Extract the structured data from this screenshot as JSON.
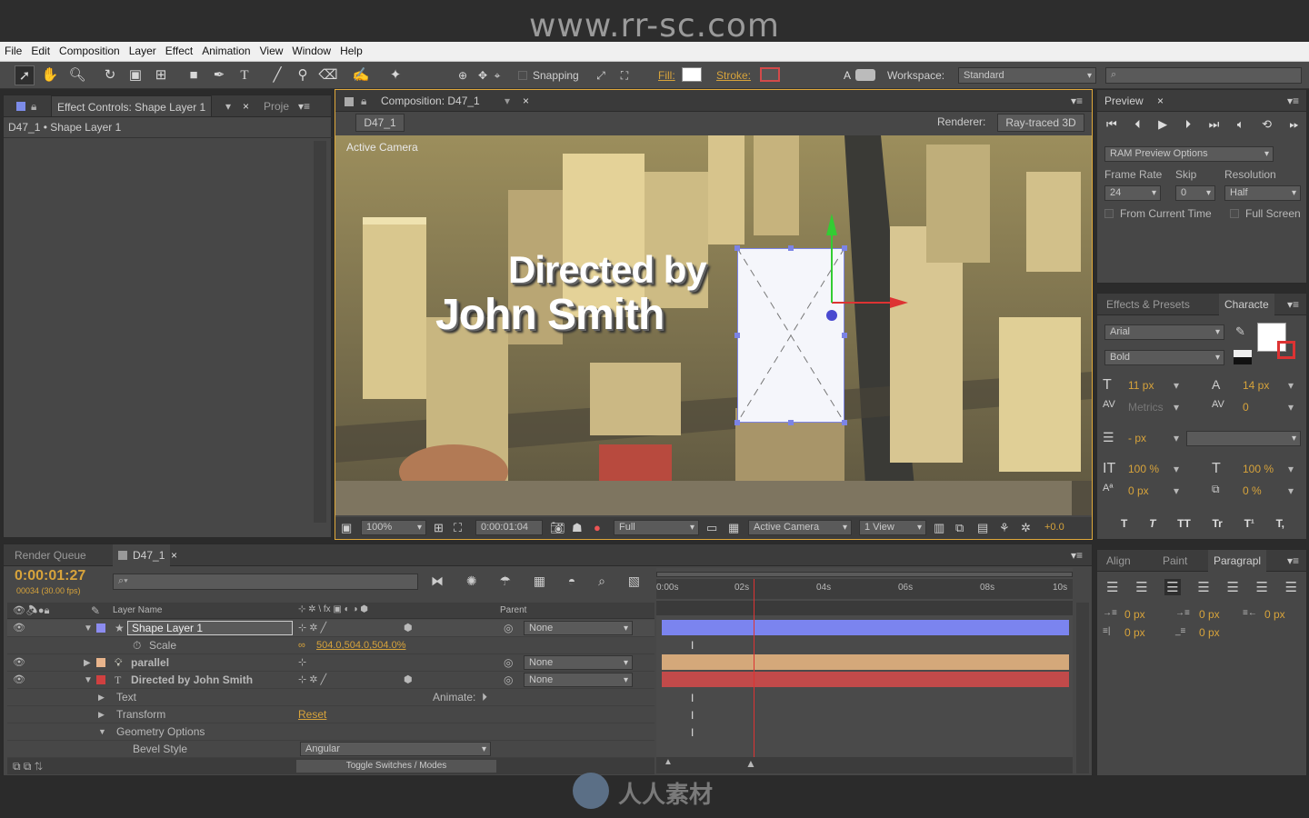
{
  "watermark": "www.rr-sc.com",
  "menu": [
    "File",
    "Edit",
    "Composition",
    "Layer",
    "Effect",
    "Animation",
    "View",
    "Window",
    "Help"
  ],
  "toolbar": {
    "snapping": "Snapping",
    "fill": "Fill:",
    "stroke": "Stroke:",
    "workspace_label": "Workspace:",
    "workspace_value": "Standard",
    "search_placeholder": ""
  },
  "left_panel": {
    "tab": "Effect Controls: Shape Layer 1",
    "tab2": "Proje",
    "breadcrumb": "D47_1 • Shape Layer 1"
  },
  "comp": {
    "tab": "Composition: D47_1",
    "subtab": "D47_1",
    "renderer_label": "Renderer:",
    "renderer_value": "Ray-traced 3D",
    "camera_label": "Active Camera",
    "title_line1": "Directed by",
    "title_line2": "John Smith",
    "footer": {
      "zoom": "100%",
      "timecode": "0:00:01:04",
      "resolution": "Full",
      "camera": "Active Camera",
      "views": "1 View",
      "exposure": "+0.0"
    }
  },
  "preview": {
    "tab": "Preview",
    "ram": "RAM Preview Options",
    "frame_rate_label": "Frame Rate",
    "skip_label": "Skip",
    "resolution_label": "Resolution",
    "frame_rate": "24",
    "skip": "0",
    "resolution": "Half",
    "from_current": "From Current Time",
    "full_screen": "Full Screen"
  },
  "character": {
    "tab1": "Effects & Presets",
    "tab2": "Characte",
    "font": "Arial",
    "style": "Bold",
    "size": "11 px",
    "leading": "14 px",
    "kerning": "Metrics",
    "tracking": "0",
    "stroke_px": "- px",
    "vscale": "100 %",
    "hscale": "100 %",
    "baseline": "0 px",
    "tsume": "0 %",
    "styles": [
      "T",
      "T",
      "TT",
      "Tr",
      "T¹",
      "T,"
    ]
  },
  "paragraph": {
    "tab1": "Align",
    "tab2": "Paint",
    "tab3": "Paragrapl",
    "indent1": "0 px",
    "indent2": "0 px",
    "indent3": "0 px",
    "space1": "0 px",
    "space2": "0 px"
  },
  "timeline": {
    "tab1": "Render Queue",
    "tab2": "D47_1",
    "timecode": "0:00:01:27",
    "fps": "00034 (30.00 fps)",
    "col_layer": "Layer Name",
    "col_parent": "Parent",
    "animate": "Animate:",
    "toggle": "Toggle Switches / Modes",
    "ruler": [
      "0:00s",
      "02s",
      "04s",
      "06s",
      "08s",
      "10s"
    ],
    "layers": [
      {
        "name": "Shape Layer 1",
        "parent": "None",
        "color": "#8c8cf0"
      },
      {
        "prop": "Scale",
        "value": "504.0,504.0,504.0%"
      },
      {
        "name": "parallel",
        "parent": "None",
        "color": "#e8b48c"
      },
      {
        "name": "Directed by John Smith",
        "parent": "None",
        "color": "#d04040"
      },
      {
        "prop": "Text"
      },
      {
        "prop": "Transform",
        "value": "Reset"
      },
      {
        "prop": "Geometry Options"
      },
      {
        "prop": "Bevel Style",
        "value": "Angular"
      }
    ],
    "bars": [
      {
        "color": "#7b84ef",
        "start": 0,
        "end": 1
      },
      {
        "color": "#d4a87a",
        "start": 0,
        "end": 1
      },
      {
        "color": "#c24a4a",
        "start": 0,
        "end": 1
      }
    ],
    "playhead": 0.225
  },
  "bottom_logo": "人人素材"
}
